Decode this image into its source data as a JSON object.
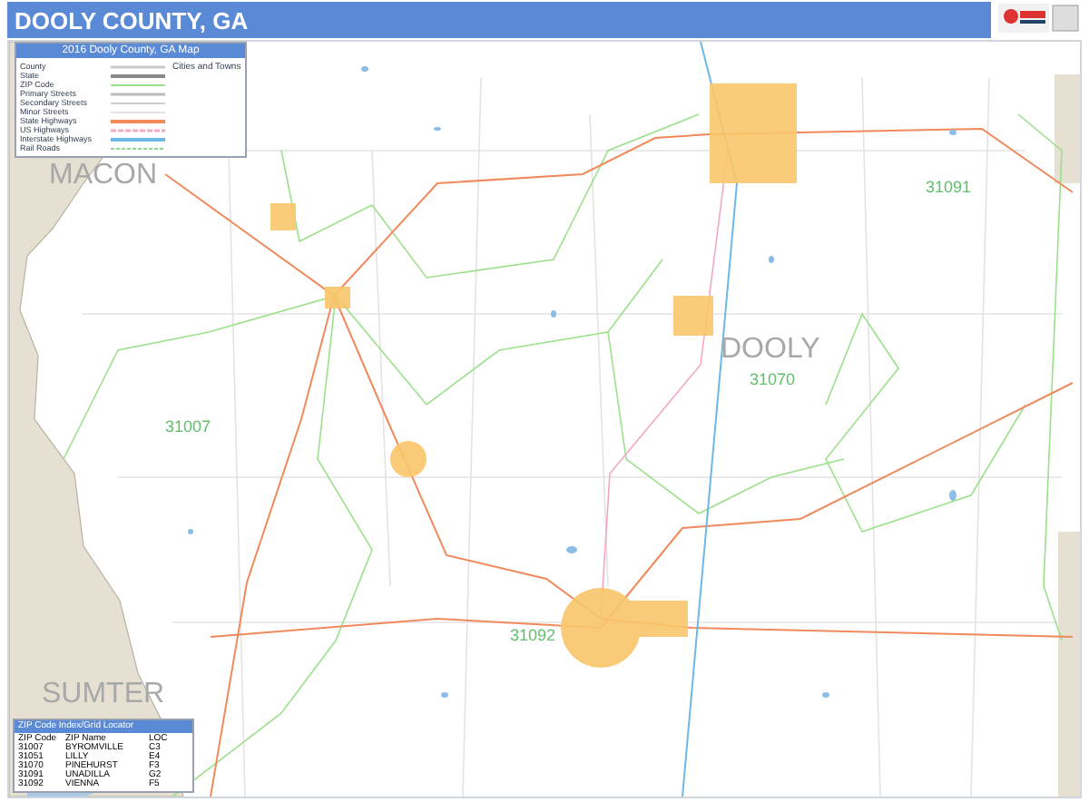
{
  "title": "DOOLY COUNTY, GA",
  "legend": {
    "title": "2016 Dooly County, GA Map",
    "cities_heading": "Cities and Towns",
    "items": [
      {
        "label": "County",
        "kind": "county"
      },
      {
        "label": "State",
        "kind": "state"
      },
      {
        "label": "ZIP Code",
        "kind": "zip"
      },
      {
        "label": "Primary Streets",
        "kind": "primary"
      },
      {
        "label": "Secondary Streets",
        "kind": "secondary"
      },
      {
        "label": "Minor Streets",
        "kind": "minor"
      },
      {
        "label": "State Highways",
        "kind": "state_hwy"
      },
      {
        "label": "US Highways",
        "kind": "us_hwy"
      },
      {
        "label": "Interstate Highways",
        "kind": "interstate"
      },
      {
        "label": "Rail Roads",
        "kind": "rail"
      }
    ]
  },
  "map_labels": [
    {
      "text": "MACON",
      "kind": "county"
    },
    {
      "text": "DOOLY",
      "kind": "county"
    },
    {
      "text": "SUMTER",
      "kind": "county"
    },
    {
      "text": "31091",
      "kind": "zip"
    },
    {
      "text": "31070",
      "kind": "zip"
    },
    {
      "text": "31007",
      "kind": "zip"
    },
    {
      "text": "31092",
      "kind": "zip"
    }
  ],
  "zip_index": {
    "title": "ZIP Code Index/Grid Locator",
    "columns": [
      "ZIP Code",
      "ZIP Name",
      "LOC"
    ],
    "rows": [
      [
        "31007",
        "BYROMVILLE",
        "C3"
      ],
      [
        "31051",
        "LILLY",
        "E4"
      ],
      [
        "31070",
        "PINEHURST",
        "F3"
      ],
      [
        "31091",
        "UNADILLA",
        "G2"
      ],
      [
        "31092",
        "VIENNA",
        "F5"
      ]
    ]
  }
}
